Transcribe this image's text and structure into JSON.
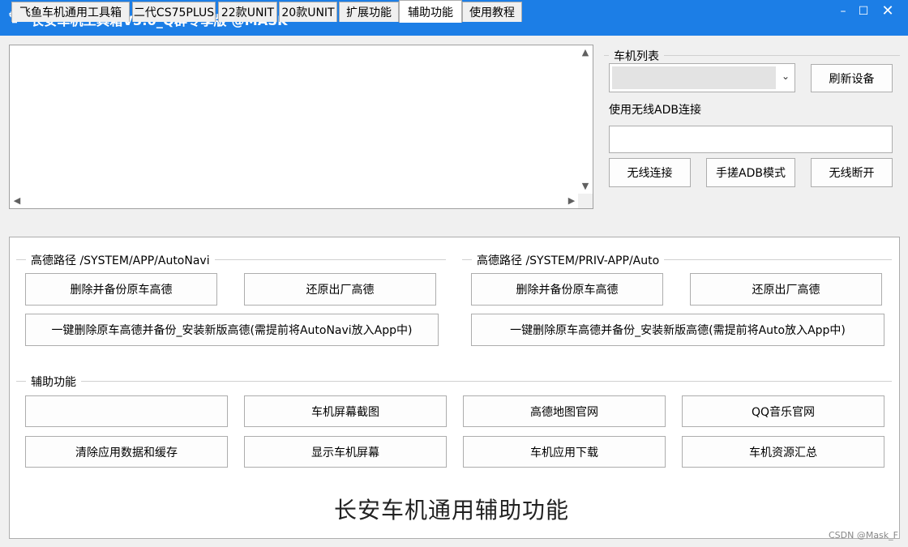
{
  "window": {
    "title": "长安车机工具箱V3.0_Q群专享版 @MASK",
    "minimize": "–",
    "maximize": "☐",
    "close": "✕"
  },
  "device_panel": {
    "list_label": "车机列表",
    "refresh_button": "刷新设备",
    "wireless_label": "使用无线ADB连接",
    "wireless_input_value": "",
    "connect_button": "无线连接",
    "manual_adb_button": "手搓ADB模式",
    "disconnect_button": "无线断开"
  },
  "tabs": [
    {
      "label": "飞鱼车机通用工具箱"
    },
    {
      "label": "二代CS75PLUS"
    },
    {
      "label": "22款UNIT"
    },
    {
      "label": "20款UNIT"
    },
    {
      "label": "扩展功能"
    },
    {
      "label": "辅助功能",
      "active": true
    },
    {
      "label": "使用教程"
    }
  ],
  "amap_left": {
    "legend": "高德路径 /SYSTEM/APP/AutoNavi",
    "delete_backup": "删除并备份原车高德",
    "restore": "还原出厂高德",
    "one_click": "一键删除原车高德并备份_安装新版高德(需提前将AutoNavi放入App中)"
  },
  "amap_right": {
    "legend": "高德路径 /SYSTEM/PRIV-APP/Auto",
    "delete_backup": "删除并备份原车高德",
    "restore": "还原出厂高德",
    "one_click": "一键删除原车高德并备份_安装新版高德(需提前将Auto放入App中)"
  },
  "aux": {
    "legend": "辅助功能",
    "row1": [
      "",
      "车机屏幕截图",
      "高德地图官网",
      "QQ音乐官网"
    ],
    "row2": [
      "清除应用数据和缓存",
      "显示车机屏幕",
      "车机应用下载",
      "车机资源汇总"
    ]
  },
  "footer_title": "长安车机通用辅助功能",
  "watermark": "CSDN @Mask_F"
}
